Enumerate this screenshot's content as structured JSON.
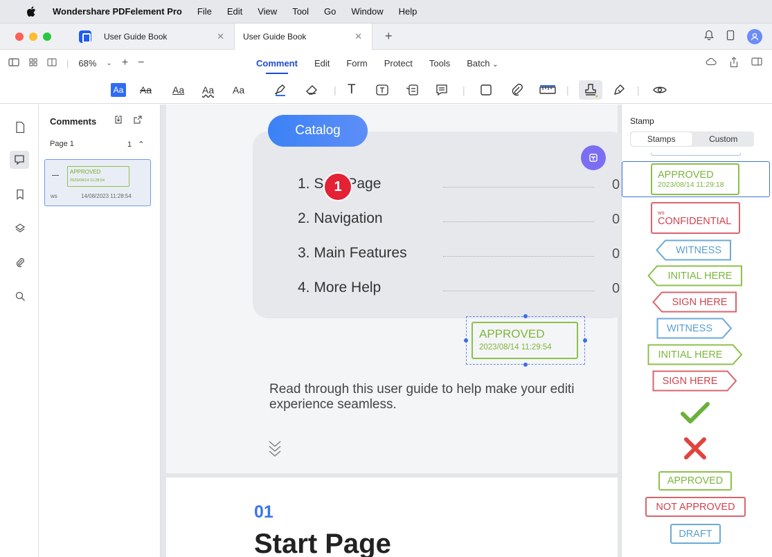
{
  "menubar": {
    "app_name": "Wondershare PDFelement Pro",
    "items": [
      "File",
      "Edit",
      "View",
      "Tool",
      "Go",
      "Window",
      "Help"
    ]
  },
  "tabs": [
    {
      "label": "User Guide Book",
      "active": false
    },
    {
      "label": "User Guide Book",
      "active": true
    }
  ],
  "toolbar": {
    "zoom": "68%",
    "menu_tabs": [
      "Comment",
      "Edit",
      "Form",
      "Protect",
      "Tools",
      "Batch"
    ],
    "active_tab": "Comment",
    "text_tools": [
      "Aa",
      "Aa",
      "Aa",
      "Aa",
      "Aa"
    ]
  },
  "comments_panel": {
    "title": "Comments",
    "page_label": "Page 1",
    "page_count": "1",
    "item": {
      "stamp_text": "APPROVED",
      "stamp_date": "2023/08/14 11:28:54",
      "author": "ws",
      "timestamp": "14/08/2023 11:28:54"
    }
  },
  "document": {
    "catalog_label": "Catalog",
    "toc": [
      {
        "text": "1. S",
        "text_after": "Page",
        "num": "0"
      },
      {
        "text": "2. Navigation",
        "num": "0"
      },
      {
        "text": "3. Main Features",
        "num": "0"
      },
      {
        "text": "4. More Help",
        "num": "0"
      }
    ],
    "step_badge": "1",
    "placed_stamp": {
      "title": "APPROVED",
      "date": "2023/08/14 11:29:54"
    },
    "intro_line1": "Read through this user guide to help make your editi",
    "intro_line2": "experience seamless.",
    "section_number": "01",
    "section_title": "Start Page"
  },
  "stamp_panel": {
    "title": "Stamp",
    "seg_tabs": [
      "Stamps",
      "Custom"
    ],
    "active_seg": "Stamps",
    "stamps": {
      "approved_dated": {
        "title": "APPROVED",
        "date": "2023/08/14 11:29:18"
      },
      "confidential": {
        "tag": "ws",
        "title": "CONFIDENTIAL"
      },
      "witness_left": "WITNESS",
      "initial_left": "INITIAL HERE",
      "sign_left": "SIGN HERE",
      "witness_right": "WITNESS",
      "initial_right": "INITIAL HERE",
      "sign_right": "SIGN HERE",
      "approved": "APPROVED",
      "not_approved": "NOT APPROVED",
      "draft": "DRAFT"
    }
  },
  "colors": {
    "accent": "#2f6cf5",
    "stamp_green": "#7bb53a",
    "stamp_red": "#d2424e",
    "stamp_blue": "#5c9fcf",
    "badge_red": "#e42236"
  }
}
